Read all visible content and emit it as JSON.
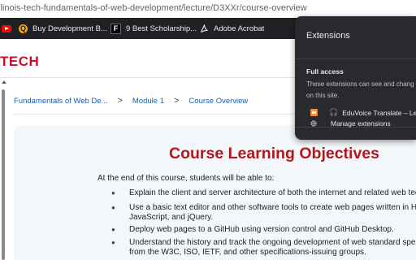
{
  "browser": {
    "url": "llinois-tech-fundamentals-of-web-development/lecture/D3XXr/course-overview",
    "bookmarks": [
      {
        "label": "",
        "icon": "youtube-icon"
      },
      {
        "label": "Buy Development B...",
        "icon": "q-logo-icon"
      },
      {
        "label": "9 Best Scholarship...",
        "icon": "f-logo-icon"
      },
      {
        "label": "Adobe Acrobat",
        "icon": "acrobat-icon"
      }
    ]
  },
  "site": {
    "brand": "TECH"
  },
  "breadcrumb": {
    "items": [
      "Fundamentals of Web De...",
      "Module 1",
      "Course Overview"
    ],
    "separator": ">"
  },
  "lecture": {
    "title": "Course Learning Objectives",
    "intro": "At the end of this course, students will be able to:",
    "objectives": [
      {
        "lines": [
          "Explain the client and server architecture of both the internet and related web tec"
        ]
      },
      {
        "lines": [
          "Use a basic text editor and other software tools to create web pages written in H",
          "JavaScript, and jQuery."
        ]
      },
      {
        "lines": [
          "Deploy web pages to a GitHub using version control and GitHub Desktop."
        ]
      },
      {
        "lines": [
          "Understand the history and track the ongoing development of web standard spec",
          "from the W3C, ISO, IETF, and other specifications-issuing groups."
        ]
      }
    ]
  },
  "extensions_popup": {
    "title": "Extensions",
    "section_title": "Full access",
    "description_lines": [
      "These extensions can see and chang",
      "on this site."
    ],
    "items": [
      {
        "label": "EduVoice Translate – Le...",
        "icon": "eduvoice-icon"
      }
    ],
    "manage_label": "Manage extensions"
  },
  "colors": {
    "brand_red": "#c8102e",
    "title_red": "#b4161b",
    "link_blue": "#1a5fb4",
    "popup_bg": "#292a2d",
    "bookmarks_bg": "#202124"
  }
}
